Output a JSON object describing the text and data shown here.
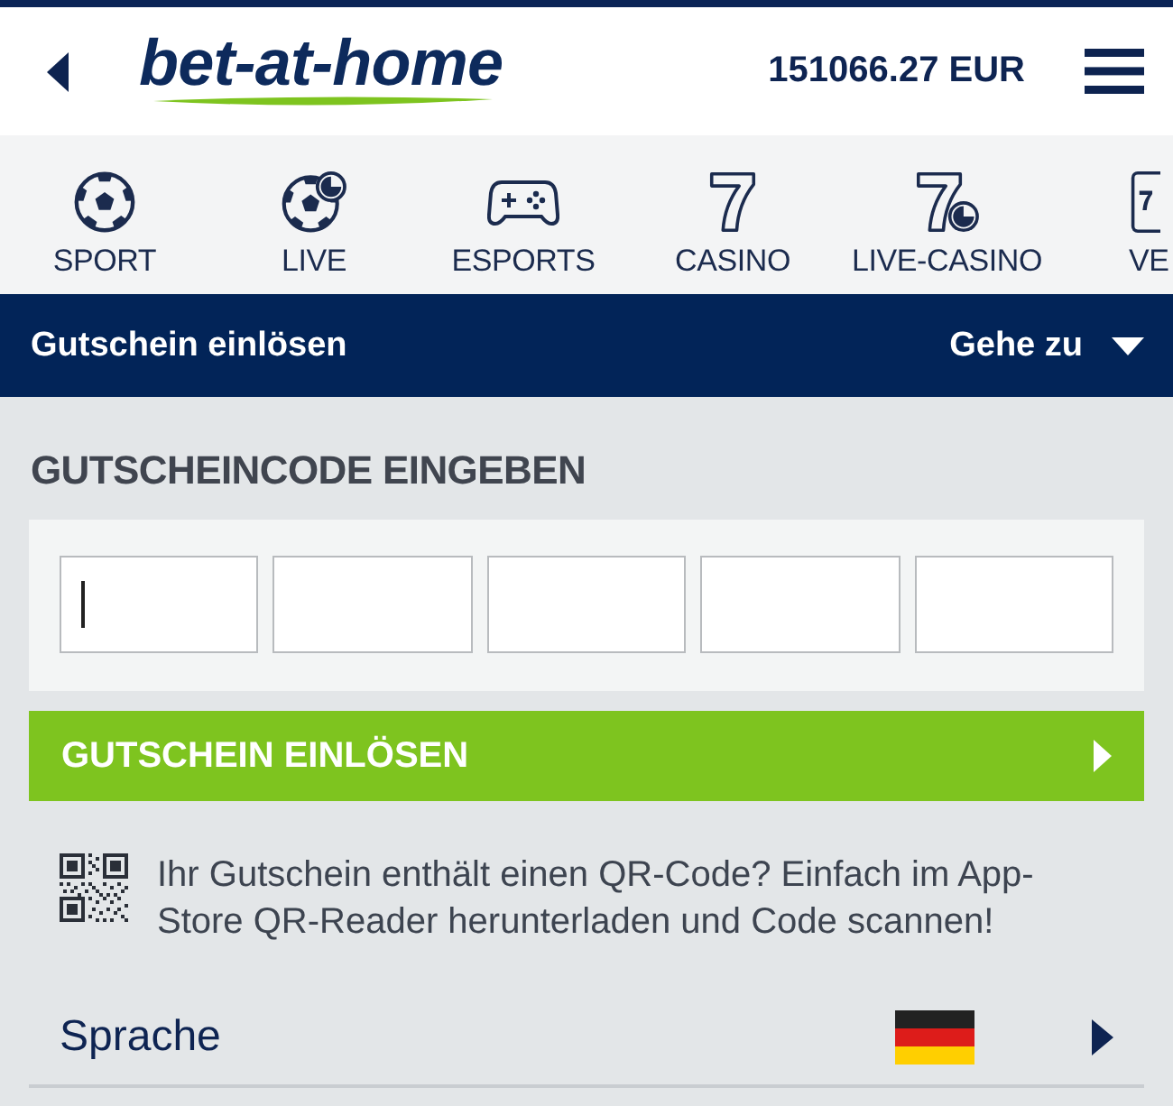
{
  "header": {
    "logo": "bet-at-home",
    "balance": "151066.27 EUR"
  },
  "nav": {
    "items": [
      {
        "label": "SPORT",
        "kind": "ball",
        "cut": false
      },
      {
        "label": "LIVE",
        "kind": "live-ball",
        "cut": false
      },
      {
        "label": "ESPORTS",
        "kind": "gamepad",
        "cut": false
      },
      {
        "label": "CASINO",
        "kind": "seven",
        "cut": false
      },
      {
        "label": "LIVE-CASINO",
        "kind": "live-seven",
        "cut": false
      },
      {
        "label": "VE",
        "kind": "seven-tile",
        "cut": true
      }
    ]
  },
  "section_bar": {
    "title": "Gutschein einlösen",
    "goto": "Gehe zu"
  },
  "voucher": {
    "heading": "GUTSCHEINCODE EINGEBEN",
    "code_fields": [
      {
        "focused": true
      },
      {
        "focused": false
      },
      {
        "focused": false
      },
      {
        "focused": false
      },
      {
        "focused": false
      }
    ],
    "submit": "GUTSCHEIN EINLÖSEN",
    "qr_hint": "Ihr Gutschein enthält einen QR-Code? Einfach im App-Store QR-Reader herunterladen und Code scannen!"
  },
  "language": {
    "label": "Sprache"
  }
}
